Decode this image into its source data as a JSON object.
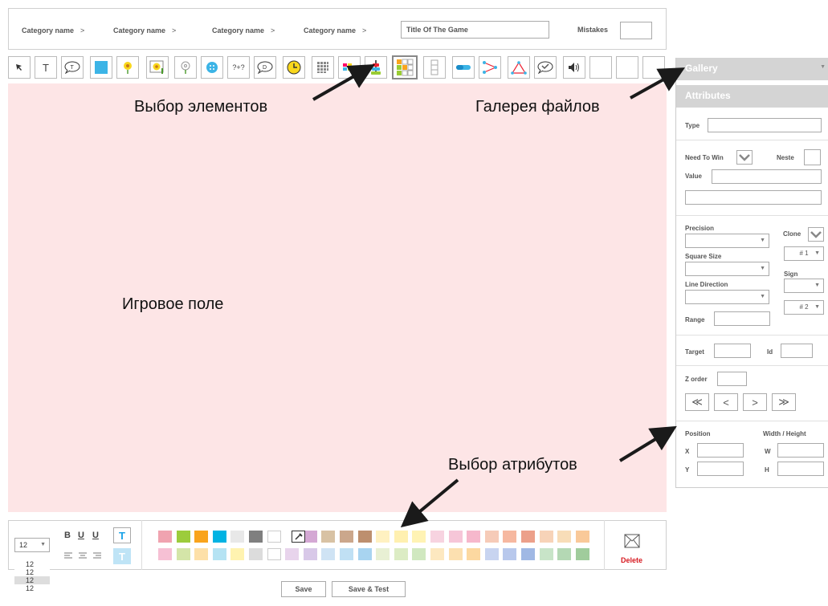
{
  "header": {
    "breadcrumbs": [
      "Category name",
      "Category name",
      "Category name",
      "Category name"
    ],
    "separator": ">",
    "game_title": "Title Of The Game",
    "mistakes_label": "Mistakes"
  },
  "toolbar": {
    "text_tool_glyph": "T",
    "question_tool_glyph": "?+?"
  },
  "panel": {
    "gallery_label": "Gallery",
    "attributes_label": "Attributes",
    "type_label": "Type",
    "need_to_win_label": "Need To Win",
    "neste_label": "Neste",
    "value_label": "Value",
    "precision_label": "Precision",
    "clone_label": "Clone",
    "square_size_label": "Square Size",
    "sign_label": "Sign",
    "line_direction_label": "Line Direction",
    "range_label": "Range",
    "clone_select_1": "# 1",
    "clone_select_2": "# 2",
    "target_label": "Target",
    "id_label": "Id",
    "z_order_label": "Z order",
    "position_label": "Position",
    "width_height_label": "Width / Height",
    "x_label": "X",
    "y_label": "Y",
    "w_label": "W",
    "h_label": "H"
  },
  "bottom": {
    "font_size_value": "12",
    "font_size_options": [
      "12",
      "12",
      "12",
      "12"
    ],
    "bold": "B",
    "underline": "U",
    "underline_alt": "U",
    "text_color_glyph": "T",
    "delete_label": "Delete",
    "colors_row1": [
      "#f0a3b0",
      "#9ccc3c",
      "#f9a41c",
      "#00b3e3",
      "#e8e8e8",
      "#7f7f7f",
      "#ffffff",
      "#ffffff",
      "#d4a8d4",
      "#d8c2a4",
      "#cba78c",
      "#bd8f6e",
      "#fff1c1",
      "#fff0b0",
      "#fff3b4",
      "#f7d3e0",
      "#f6c6d8",
      "#f6b8cc",
      "#f6cbb8",
      "#f6b8a0",
      "#eca08a",
      "#f7d3b8",
      "#f8ddb8",
      "#f9c999"
    ],
    "colors_row2": [
      "#f6c0d4",
      "#d4e5a8",
      "#fde0a8",
      "#b5e3f3",
      "#fff3b0",
      "#dcdcdc",
      "#ffffff",
      "#e8d4ec",
      "#d8c8e8",
      "#cfe3f4",
      "#c0e0f4",
      "#a8d4f0",
      "#e8f0d4",
      "#dcecc4",
      "#d0e8c0",
      "#fde8c0",
      "#fce0b0",
      "#fcd8a0",
      "#c8d4f0",
      "#b8c8ec",
      "#a0b8e4",
      "#c8e4c8",
      "#b4d8b4",
      "#a0cc9c"
    ]
  },
  "buttons": {
    "save": "Save",
    "save_test": "Save & Test"
  },
  "annotations": {
    "select_elements": "Выбор элементов",
    "file_gallery": "Галерея файлов",
    "game_field": "Игровое поле",
    "select_attributes": "Выбор атрибутов"
  },
  "colors": {
    "field_bg": "#fde5e6",
    "panel_header": "#d4d4d4",
    "delete_red": "#d71920",
    "text_color_accent": "#1aa3e8"
  }
}
